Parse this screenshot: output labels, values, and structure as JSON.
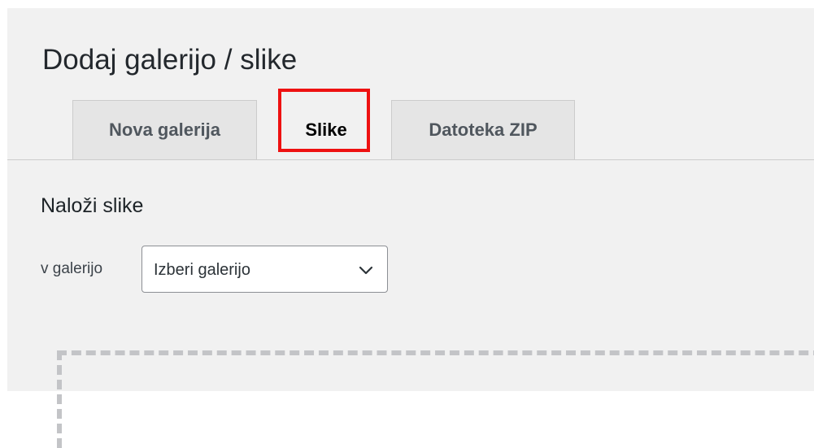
{
  "page": {
    "title": "Dodaj galerijo / slike"
  },
  "tabs": [
    {
      "label": "Nova galerija",
      "active": false
    },
    {
      "label": "Slike",
      "active": true
    },
    {
      "label": "Datoteka ZIP",
      "active": false
    }
  ],
  "upload": {
    "section_title": "Naloži slike",
    "gallery_label": "v galerijo",
    "gallery_select": {
      "selected": "Izberi galerijo"
    }
  },
  "colors": {
    "panel_background": "#f1f1f1",
    "tab_background": "#e5e5e5",
    "highlight": "#ee1111",
    "dropzone_border": "#c3c4c7"
  },
  "icons": {
    "select_arrow": "chevron-down-icon"
  }
}
